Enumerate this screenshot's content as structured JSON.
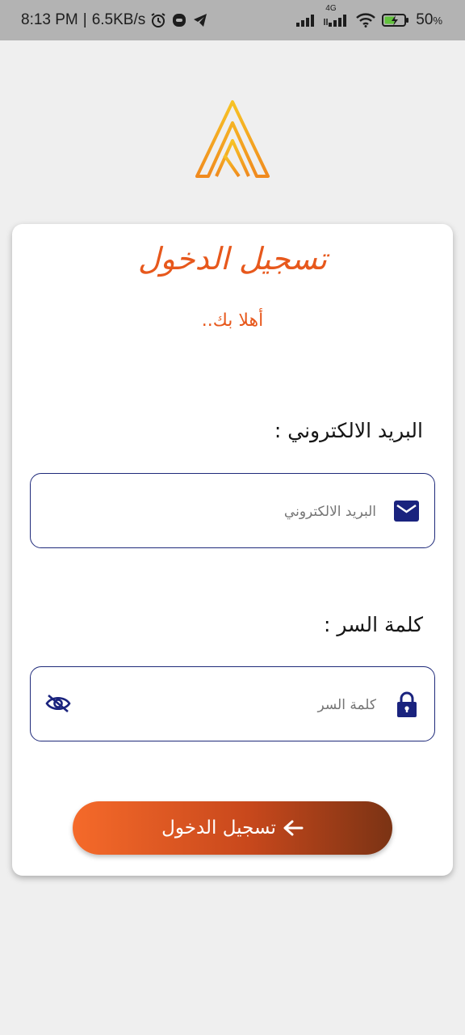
{
  "status_bar": {
    "time": "8:13 PM",
    "separator": "|",
    "speed": "6.5KB/s",
    "network_type": "4G",
    "battery_percent": "50",
    "battery_percent_sign": "%",
    "icons": [
      "alarm-icon",
      "messenger-icon",
      "telegram-icon",
      "signal-icon",
      "signal-4g-icon",
      "wifi-icon",
      "battery-charging-icon"
    ]
  },
  "login": {
    "title": "تسجيل الدخول",
    "subtitle": "أهلا بك..",
    "email": {
      "label": "البريد الالكتروني :",
      "placeholder": "البريد الالكتروني",
      "value": "",
      "icon": "mail-icon"
    },
    "password": {
      "label": "كلمة السر :",
      "placeholder": "كلمة السر",
      "value": "",
      "icon": "lock-icon",
      "toggle_icon": "eye-off-icon"
    },
    "submit": {
      "label": "تسجيل الدخول",
      "icon": "arrow-left-icon"
    }
  },
  "colors": {
    "accent": "#e7581c",
    "field_border": "#1f2a7a",
    "icon": "#1a237e",
    "button_gradient_start": "#f56a2a",
    "button_gradient_end": "#7b3314",
    "logo_gradient": [
      "#f7c325",
      "#f08a1f"
    ]
  }
}
